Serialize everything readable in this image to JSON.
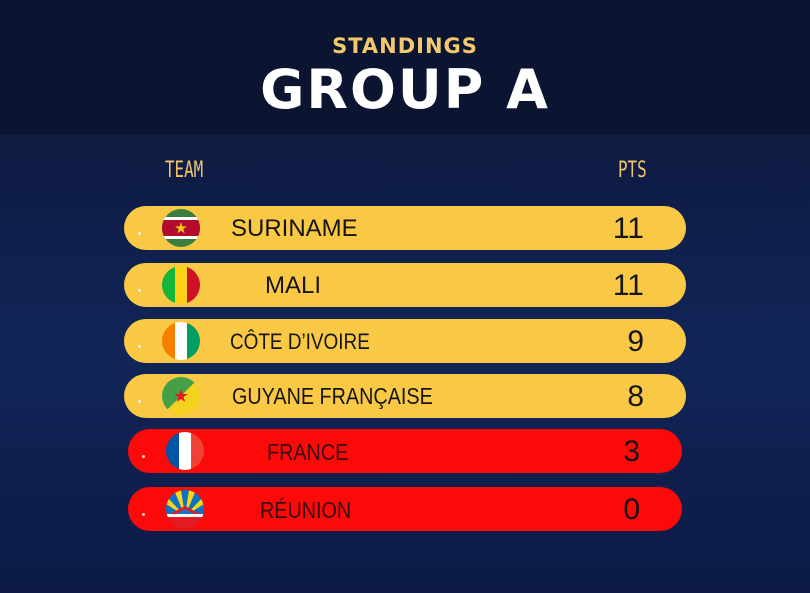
{
  "header": {
    "subtitle": "STANDINGS",
    "title": "GROUP A"
  },
  "columns": {
    "team": "TEAM",
    "points": "PTS"
  },
  "rows": [
    {
      "team": "SURINAME",
      "points": "11",
      "flag": "suriname-flag",
      "color": "#f9c844"
    },
    {
      "team": "MALI",
      "points": "11",
      "flag": "mali-flag",
      "color": "#f9c844"
    },
    {
      "team": "CÔTE D’IVOIRE",
      "points": "9",
      "flag": "cote-divoire-flag",
      "color": "#f9c844"
    },
    {
      "team": "GUYANE FRANÇAISE",
      "points": "8",
      "flag": "french-guiana-flag",
      "color": "#f9c844"
    },
    {
      "team": "FRANCE",
      "points": "3",
      "flag": "france-flag",
      "color": "#fc0a0a"
    },
    {
      "team": "RÉUNION",
      "points": "0",
      "flag": "reunion-flag",
      "color": "#fc0a0a"
    }
  ],
  "colors": {
    "background": "#0f1d46",
    "accent_gold": "#f3c96b",
    "qualify_row": "#f9c844",
    "eliminated_row": "#fc0a0a"
  }
}
